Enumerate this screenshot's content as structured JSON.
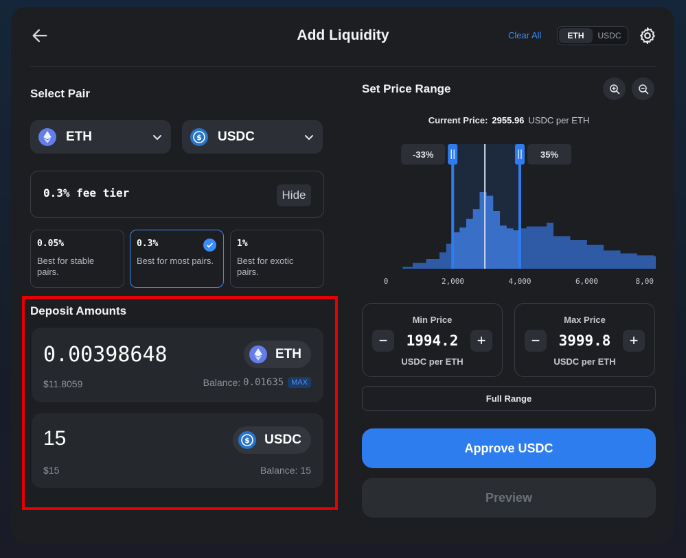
{
  "header": {
    "title": "Add Liquidity",
    "clear_all": "Clear All",
    "toggle": [
      "ETH",
      "USDC"
    ]
  },
  "pair": {
    "title": "Select Pair",
    "token_a": "ETH",
    "token_b": "USDC"
  },
  "fee": {
    "current": "0.3% fee tier",
    "hide_label": "Hide",
    "tiers": [
      {
        "pct": "0.05%",
        "desc": "Best for stable pairs."
      },
      {
        "pct": "0.3%",
        "desc": "Best for most pairs."
      },
      {
        "pct": "1%",
        "desc": "Best for exotic pairs."
      }
    ]
  },
  "deposit": {
    "title": "Deposit Amounts",
    "items": [
      {
        "amount": "0.00398648",
        "usd": "$11.8059",
        "balance_label": "Balance:",
        "balance": "0.01635",
        "max": "MAX",
        "token": "ETH"
      },
      {
        "amount": "15",
        "usd": "$15",
        "balance_label": "Balance:",
        "balance": "15",
        "token": "USDC"
      }
    ]
  },
  "price_range": {
    "title": "Set Price Range",
    "current_label": "Current Price:",
    "current_value": "2955.96",
    "current_unit": "USDC per ETH",
    "min": {
      "label": "Min Price",
      "value": "1994.2",
      "unit": "USDC per ETH"
    },
    "max": {
      "label": "Max Price",
      "value": "3999.8",
      "unit": "USDC per ETH"
    },
    "full_range": "Full Range"
  },
  "actions": {
    "approve": "Approve USDC",
    "preview": "Preview"
  },
  "chart_data": {
    "type": "area",
    "x_ticks": [
      "0",
      "2,000",
      "4,000",
      "6,000",
      "8,00"
    ],
    "xlim": [
      0,
      8000
    ],
    "current_price": 2955.96,
    "range_min": 1994.2,
    "range_max": 3999.8,
    "range_min_label": "-33%",
    "range_max_label": "35%",
    "liquidity": [
      {
        "x": 500,
        "y": 2
      },
      {
        "x": 800,
        "y": 6
      },
      {
        "x": 1200,
        "y": 10
      },
      {
        "x": 1600,
        "y": 17
      },
      {
        "x": 1800,
        "y": 26
      },
      {
        "x": 2000,
        "y": 38
      },
      {
        "x": 2200,
        "y": 43
      },
      {
        "x": 2400,
        "y": 52
      },
      {
        "x": 2600,
        "y": 62
      },
      {
        "x": 2800,
        "y": 80
      },
      {
        "x": 3000,
        "y": 76
      },
      {
        "x": 3200,
        "y": 60
      },
      {
        "x": 3400,
        "y": 45
      },
      {
        "x": 3600,
        "y": 42
      },
      {
        "x": 3800,
        "y": 40
      },
      {
        "x": 4000,
        "y": 42
      },
      {
        "x": 4200,
        "y": 44
      },
      {
        "x": 4500,
        "y": 44
      },
      {
        "x": 4800,
        "y": 48
      },
      {
        "x": 5000,
        "y": 34
      },
      {
        "x": 5500,
        "y": 30
      },
      {
        "x": 6000,
        "y": 25
      },
      {
        "x": 6500,
        "y": 19
      },
      {
        "x": 7000,
        "y": 16
      },
      {
        "x": 7500,
        "y": 14
      },
      {
        "x": 8000,
        "y": 13
      }
    ],
    "colors": {
      "fill": "#2e5aa6",
      "in_range": "#3a6fc8",
      "handle": "#2e7def",
      "current": "#c9d6ee"
    }
  }
}
